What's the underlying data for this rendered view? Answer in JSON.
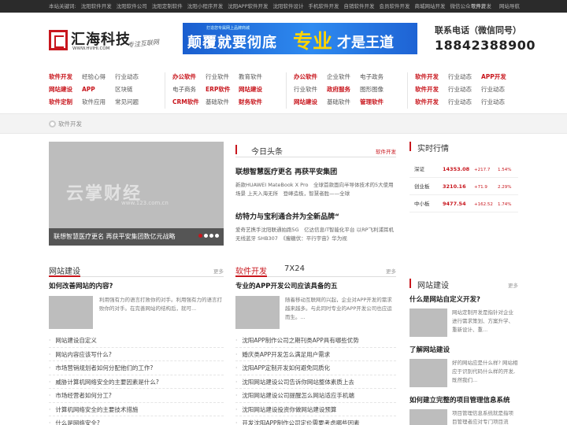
{
  "topbar": {
    "keywords": [
      "本站关键词:",
      "沈阳软件开发",
      "沈阳软件公司",
      "沈阳定制软件",
      "沈阳小程序开发",
      "沈阳APP软件开发",
      "沈阳软件设计",
      "手机软件开发",
      "自销软件开发",
      "会员软件开发",
      "商城网站开发",
      "微信公众号开发"
    ],
    "right": [
      "软件开发",
      "网站导航"
    ]
  },
  "header": {
    "logo_title": "汇海科技",
    "logo_url": "WWW.HVIHI.COM",
    "logo_slogan": "专注互联网",
    "banner_small": "打造您专属网上品牌商城",
    "banner_main": "颠覆就要彻底",
    "banner_pro": "专业",
    "banner_tail": "才是王道",
    "contact_label": "联系电话（微信同号）",
    "contact_phone": "18842388900"
  },
  "nav": {
    "groups": [
      [
        [
          "软件开发",
          "经验心得",
          "行业动态"
        ],
        [
          "网站建设",
          "APP",
          "区块链"
        ],
        [
          "软件定制",
          "软件应用",
          "常见问题"
        ]
      ],
      [
        [
          "办公软件",
          "行业软件",
          "教育软件"
        ],
        [
          "电子商务",
          "ERP软件",
          "网站建设"
        ],
        [
          "CRM软件",
          "基础软件",
          "财务软件"
        ]
      ],
      [
        [
          "办公软件",
          "企业软件",
          "电子政务"
        ],
        [
          "行业软件",
          "政府服务",
          "图形图像"
        ],
        [
          "网站建设",
          "基础软件",
          "管理软件"
        ]
      ],
      [
        [
          "软件开发",
          "行业动态",
          "APP开发"
        ],
        [
          "软件开发",
          "行业动态",
          "行业动态"
        ],
        [
          "软件开发",
          "行业动态",
          "行业动态"
        ]
      ]
    ],
    "red": [
      [
        [
          true,
          false,
          false
        ],
        [
          true,
          true,
          false
        ],
        [
          true,
          false,
          false
        ]
      ],
      [
        [
          true,
          false,
          false
        ],
        [
          false,
          true,
          true
        ],
        [
          true,
          false,
          true
        ]
      ],
      [
        [
          true,
          false,
          false
        ],
        [
          false,
          true,
          false
        ],
        [
          true,
          false,
          true
        ]
      ],
      [
        [
          true,
          false,
          true
        ],
        [
          true,
          false,
          false
        ],
        [
          true,
          false,
          false
        ]
      ]
    ]
  },
  "breadcrumb": {
    "label": "软件开发"
  },
  "slider": {
    "watermark": "云掌财经",
    "watermark_url": "www.123.com.cn",
    "caption": "联想智慧医疗更名 再获平安集团数亿元战略"
  },
  "today": {
    "title": "今日头条",
    "more": "软件开发",
    "items": [
      {
        "title": "联想智慧医疗更名 再获平安集团",
        "text": "新款HUAWEI MateBook X Pro　全球首款面向半导体技术的5大使用场景 上天入海无所　登峰造极，智慧者胜——全球"
      },
      {
        "title": "纺特力与宝利通合并为全新品牌“",
        "text": "爱奇艺携手沈阳联通拍跑5G　亿达信息IT智能化平台 以RP飞利浦耳机无线蓝牙 SHB307　《瘦糖伏：平行宇宙》华为视"
      }
    ]
  },
  "market": {
    "title": "实时行情",
    "rows": [
      {
        "name": "深证",
        "value": "14353.08",
        "change": "+217.7",
        "pct": "1.54%"
      },
      {
        "name": "创业板",
        "value": "3210.16",
        "change": "+71.9",
        "pct": "2.29%"
      },
      {
        "name": "中小板",
        "value": "9477.54",
        "change": "+162.52",
        "pct": "1.74%"
      }
    ]
  },
  "website": {
    "title": "网站建设",
    "more": "更多",
    "feature_title": "如何改善网站的内容?",
    "feature_text": "利用强有力的语言打败你的对手。利用强有力的语言打败你的对手。在完善网站的结构后，就可...",
    "items": [
      "网站建设自定义",
      "网站内容应该写什么?",
      "市场营销规划者如何分配他们的工作?",
      "威胁计算机网络安全的主要因素是什么?",
      "市场经营者如何分工?",
      "计算机网络安全的主要技术措施",
      "什么是网络安全?"
    ]
  },
  "software": {
    "title": "软件开发",
    "tab2": "7X24",
    "more": "更多",
    "feature_title": "专业的APP开发公司应该具备的五",
    "feature_text": "随着移动互联网的兴起，企业对APP开发的需求越来越多。与此同时专业的APP开发公司也应运而生。...",
    "items": [
      "沈阳APP制作公司之期刊类APP具有哪些优势",
      "婚庆类APP开发怎么满足用户需求",
      "沈阳APP定制开发如何避免同质化",
      "沈阳网站建设公司告诉你网站整体素质上去",
      "沈阳网站建设公司提醒怎么网站适应手机端",
      "沈阳网站建设投资你做网站建设预算",
      "开发沈阳APP制作公司定价需要考虑哪些因素"
    ]
  },
  "sidebar_web": {
    "title": "网站建设",
    "more": "更多",
    "entries": [
      {
        "title": "什么是网站自定义开发?",
        "text": "网站定制开发是指针对企业进行需求策划、方案升学、重新设计、重..."
      },
      {
        "title": "了解网站建设",
        "text": "好的网站应是什么样? 网站相应于识别代码什么样的开发, 既然我们..."
      },
      {
        "title": "如何建立完整的项目管理信息系统",
        "text": "项目管理信息系统就是指项目管理者应对专门项目流程..."
      }
    ]
  }
}
